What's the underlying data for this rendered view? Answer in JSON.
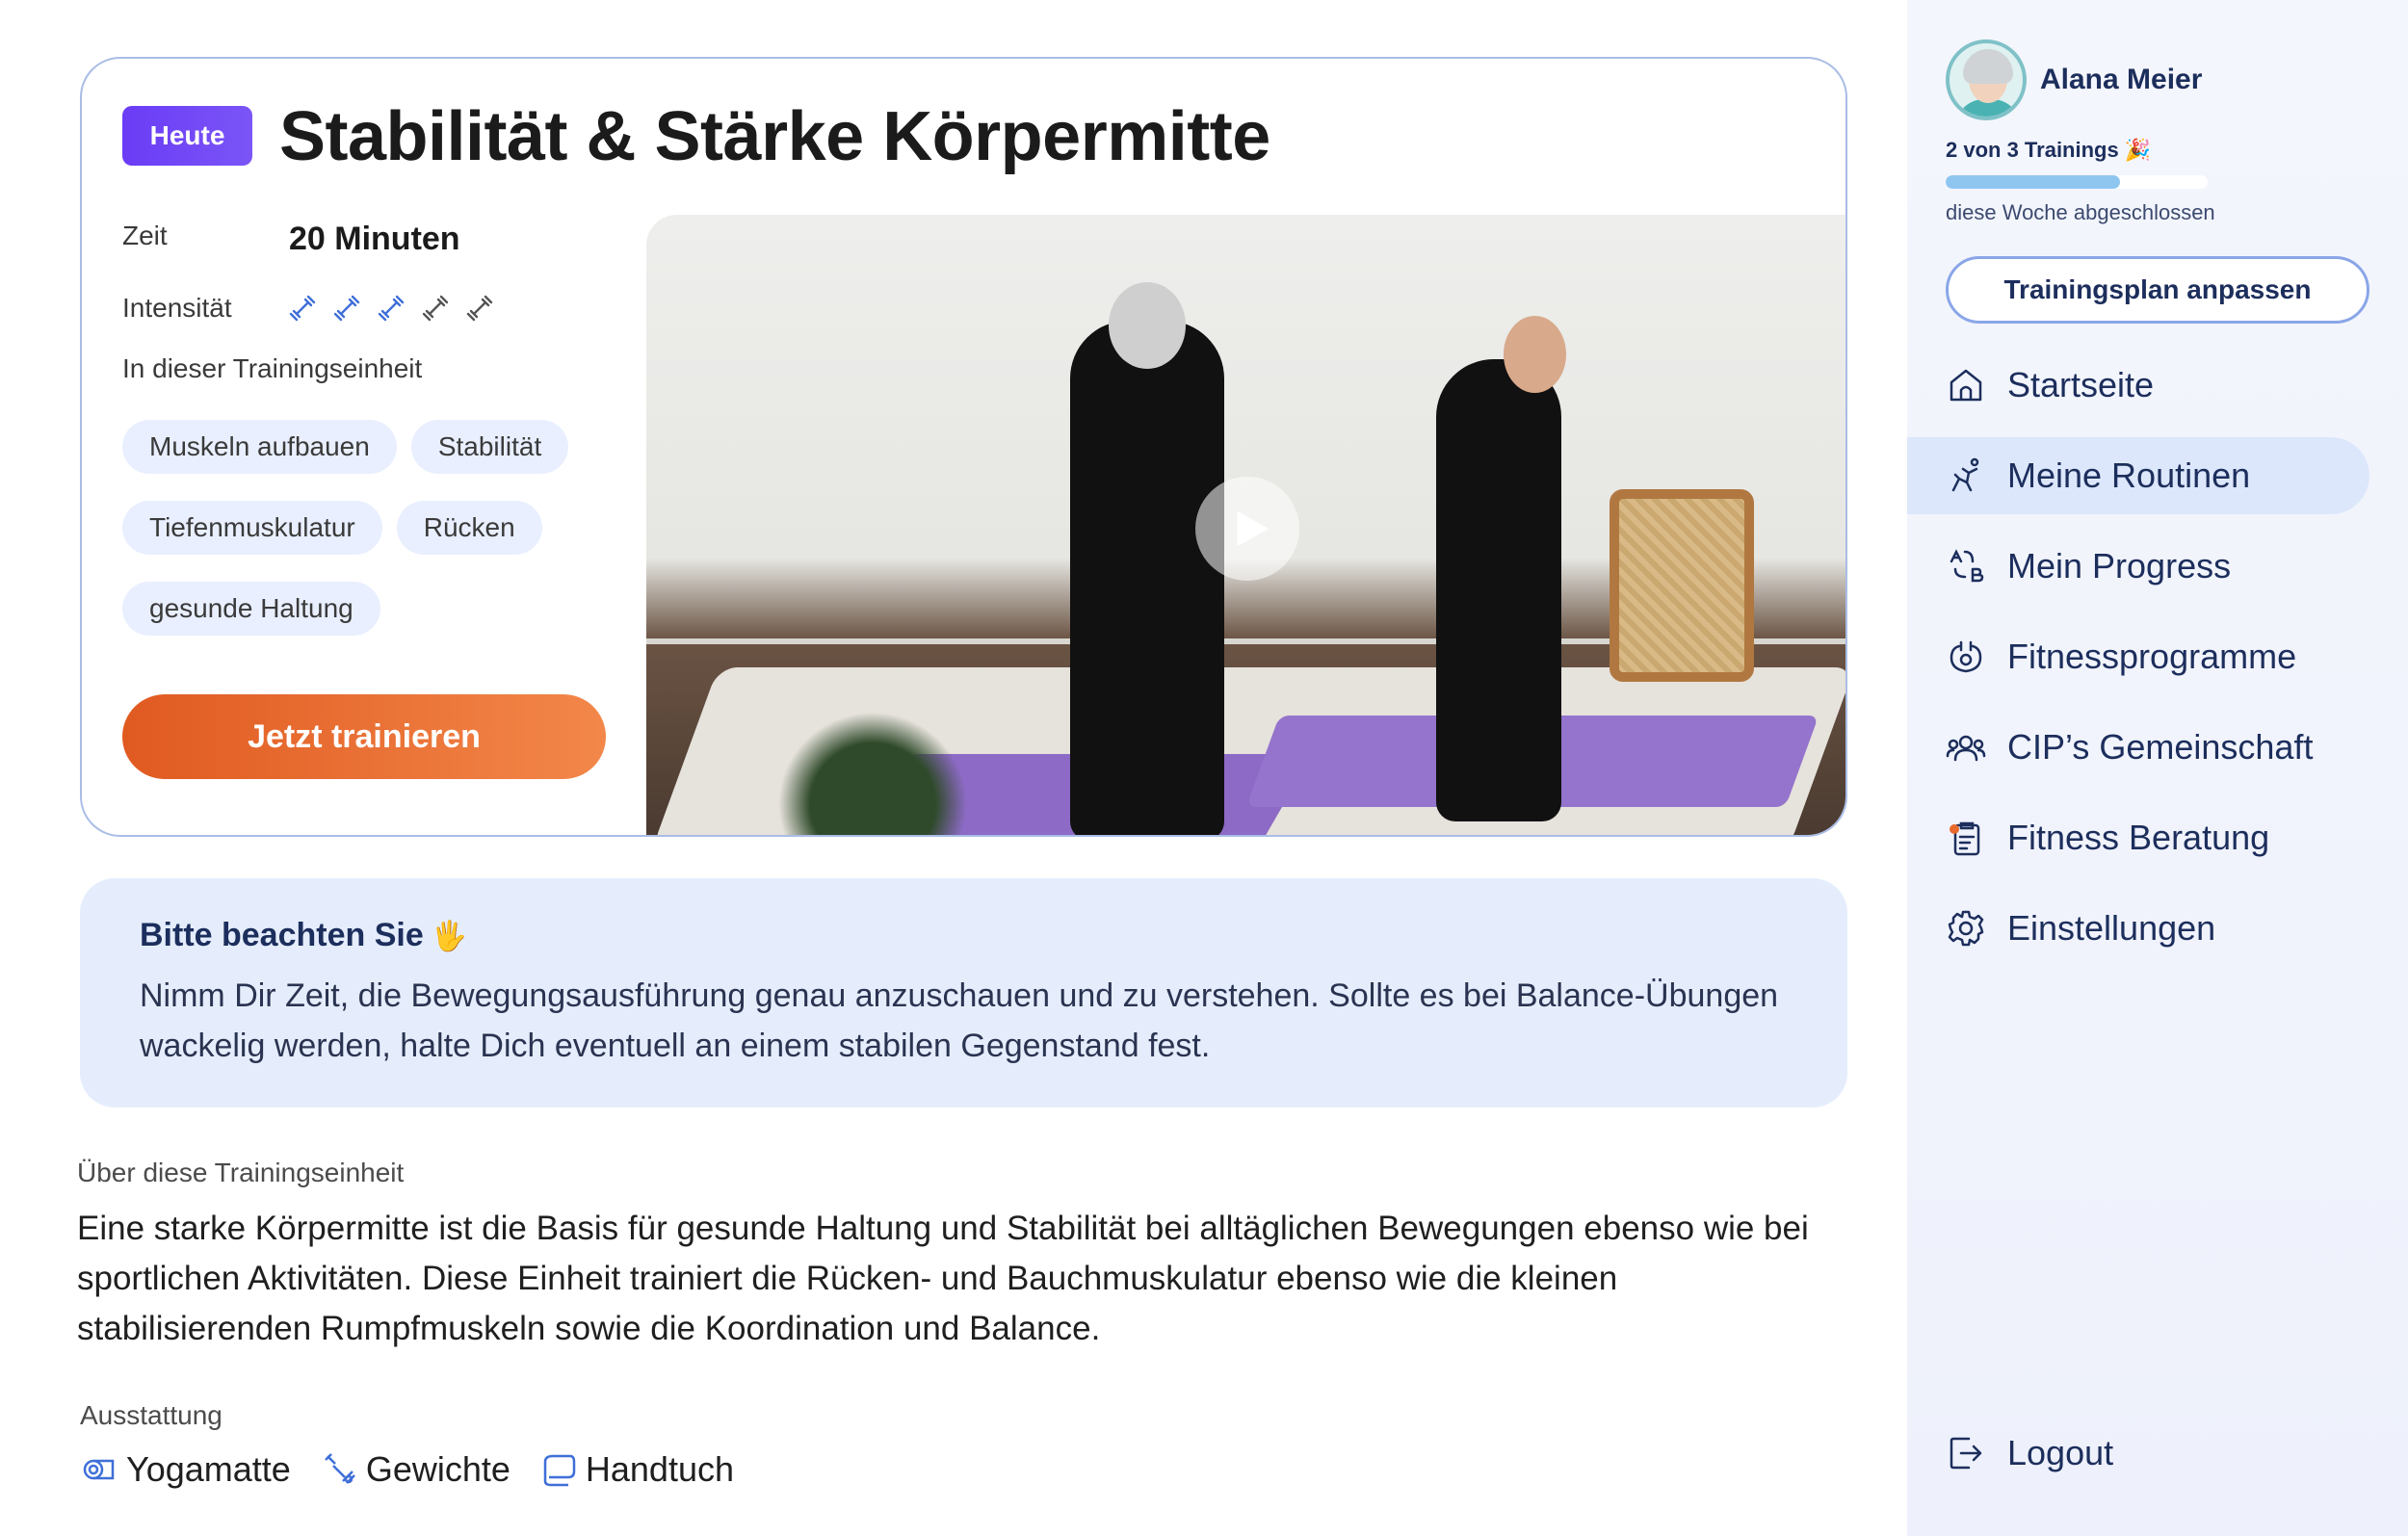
{
  "workout": {
    "badge": "Heute",
    "title": "Stabilität & Stärke Körpermitte",
    "time_label": "Zeit",
    "time_value": "20 Minuten",
    "intensity_label": "Intensität",
    "intensity_level": 3,
    "intensity_max": 5,
    "contents_label": "In dieser Trainingseinheit",
    "tags": [
      "Muskeln aufbauen",
      "Stabilität",
      "Tiefenmuskulatur",
      "Rücken",
      "gesunde Haltung"
    ],
    "cta_label": "Jetzt trainieren"
  },
  "notice": {
    "title": "Bitte beachten Sie",
    "hand": "🖐",
    "text": "Nimm Dir Zeit, die Bewegungsausführung genau anzuschauen und zu verstehen. Sollte es bei Balance-Übungen wackelig werden, halte Dich eventuell an einem stabilen Gegenstand fest."
  },
  "about": {
    "label": "Über diese Trainingseinheit",
    "text": "Eine starke Körpermitte ist die Basis für gesunde Haltung und Stabilität bei alltäglichen Bewegungen ebenso wie bei sportlichen Aktivitäten. Diese Einheit trainiert die Rücken- und Bauchmuskulatur ebenso wie die kleinen stabilisierenden Rumpfmuskeln sowie die Koordination und Balance."
  },
  "equipment": {
    "label": "Ausstattung",
    "items": [
      {
        "label": "Yogamatte",
        "icon": "yoga-mat-icon"
      },
      {
        "label": "Gewichte",
        "icon": "weights-icon"
      },
      {
        "label": "Handtuch",
        "icon": "towel-icon"
      }
    ]
  },
  "sidebar": {
    "user_name": "Alana Meier",
    "progress_text": "2 von 3 Trainings 🎉",
    "progress_done": 2,
    "progress_total": 3,
    "progress_sub": "diese Woche abgeschlossen",
    "plan_button": "Trainingsplan anpassen",
    "nav": [
      {
        "label": "Startseite",
        "icon": "home-icon",
        "active": false
      },
      {
        "label": "Meine Routinen",
        "icon": "routine-icon",
        "active": true
      },
      {
        "label": "Mein Progress",
        "icon": "progress-icon",
        "active": false
      },
      {
        "label": "Fitnessprogramme",
        "icon": "programs-icon",
        "active": false
      },
      {
        "label": "CIP’s Gemeinschaft",
        "icon": "community-icon",
        "active": false
      },
      {
        "label": "Fitness Beratung",
        "icon": "consulting-icon",
        "active": false
      },
      {
        "label": "Einstellungen",
        "icon": "settings-icon",
        "active": false
      }
    ],
    "logout": "Logout"
  },
  "colors": {
    "accent": "#6a3cf5",
    "cta": "#e8692c",
    "nav_active": "#dde7fb",
    "notice_bg": "#e5edfd",
    "text_dark": "#1c2e5c"
  }
}
